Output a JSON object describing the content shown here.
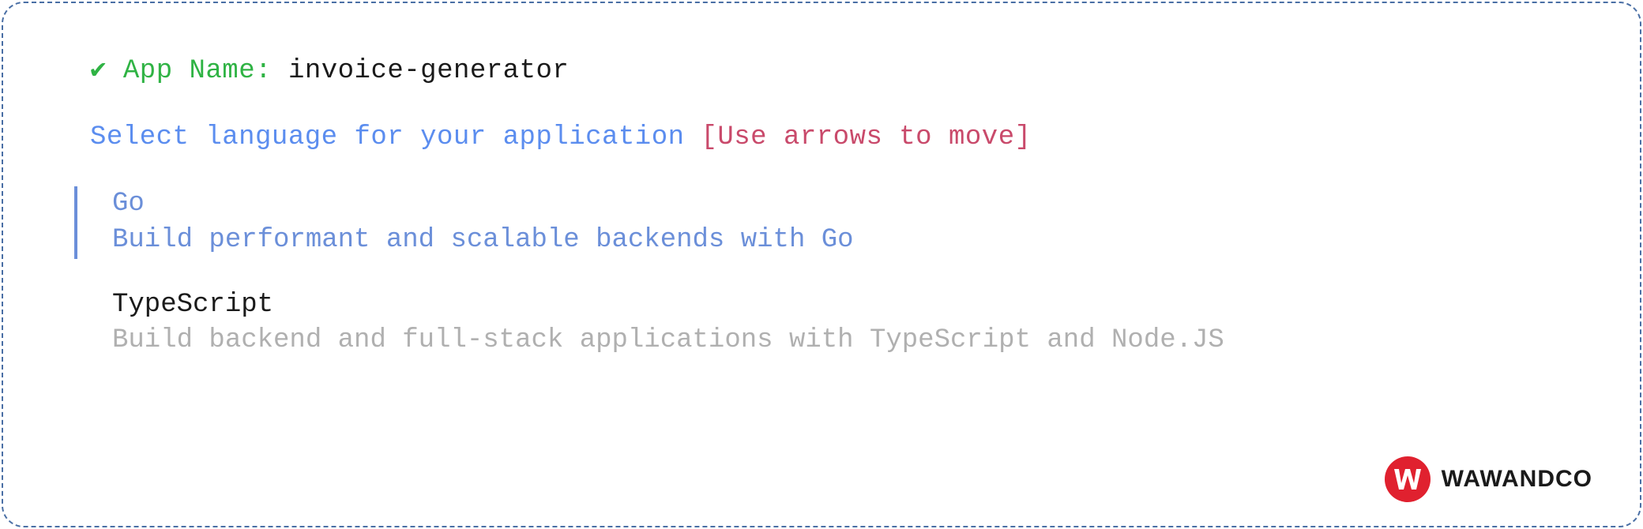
{
  "header": {
    "check_glyph": "✔",
    "label": "App Name:",
    "value": "invoice-generator"
  },
  "prompt": {
    "text": "Select language for your application",
    "hint": "[Use arrows to move]"
  },
  "options": [
    {
      "name": "Go",
      "description": "Build performant and scalable backends with Go",
      "selected": true
    },
    {
      "name": "TypeScript",
      "description": "Build backend and full-stack applications with TypeScript and Node.JS",
      "selected": false
    }
  ],
  "brand": {
    "name": "WAWANDCO",
    "logo_bg": "#e0212f",
    "logo_letter": "W"
  }
}
